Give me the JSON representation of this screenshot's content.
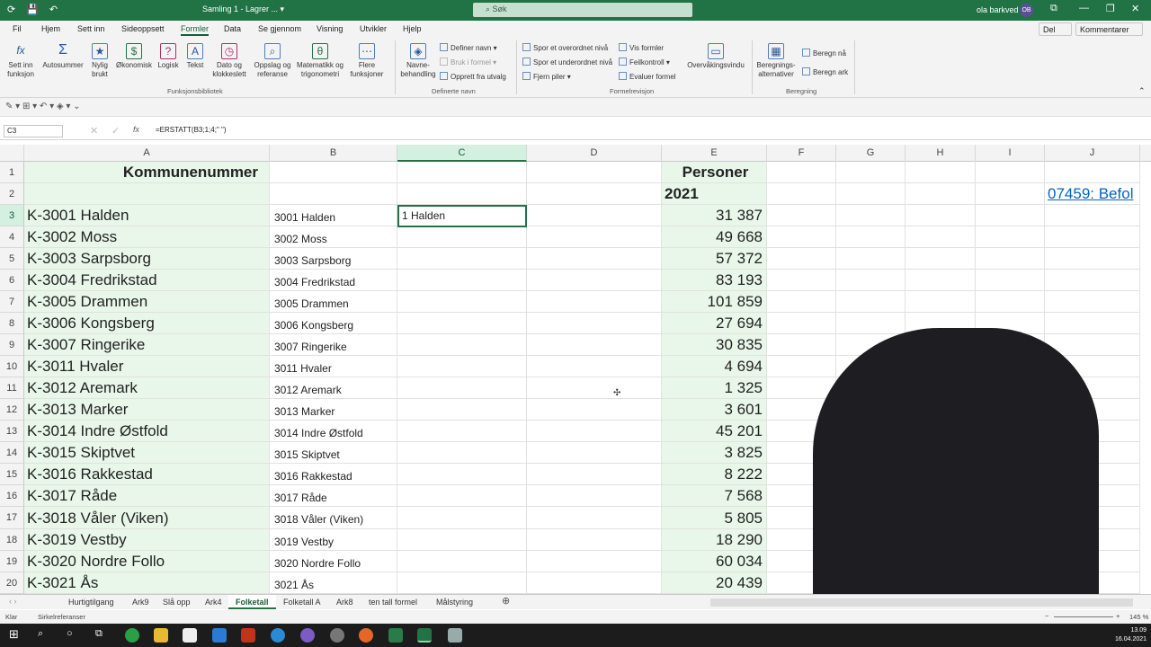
{
  "titlebar": {
    "autosave": "⟳",
    "save": "💾",
    "undo": "↶",
    "doc": "Samling 1  -  Lagrer ...  ▾",
    "search": "Søk",
    "user": "ola barkved",
    "initials": "OB",
    "minimize": "—",
    "restore": "❐",
    "close": "✕",
    "win_icon": "⧉"
  },
  "tabs": [
    "Fil",
    "Hjem",
    "Sett inn",
    "Sideoppsett",
    "Formler",
    "Data",
    "Se gjennom",
    "Visning",
    "Utvikler",
    "Hjelp"
  ],
  "share": "Del",
  "comments": "Kommentarer",
  "ribbon": {
    "big": [
      {
        "label": "Sett inn\nfunksjon",
        "icon": "fx"
      },
      {
        "label": "Autosummer",
        "icon": "Σ"
      },
      {
        "label": "Nylig\nbrukt",
        "icon": "★"
      },
      {
        "label": "Økonomisk",
        "icon": "$"
      },
      {
        "label": "Logisk",
        "icon": "?"
      },
      {
        "label": "Tekst",
        "icon": "A"
      },
      {
        "label": "Dato og\nklokkeslett",
        "icon": "◷"
      },
      {
        "label": "Oppslag og\nreferanse",
        "icon": "⌕"
      },
      {
        "label": "Matematikk og\ntrigonometri",
        "icon": "θ"
      },
      {
        "label": "Flere\nfunksjoner",
        "icon": "⋯"
      },
      {
        "label": "Navne-\nbehandling",
        "icon": "◈"
      },
      {
        "label": "Overvåkingsvindu",
        "icon": "▭"
      },
      {
        "label": "Beregnings-\nalternativer",
        "icon": "▦"
      }
    ],
    "small": [
      "Definer navn",
      "Bruk i formel",
      "Opprett fra utvalg",
      "Spor et overordnet nivå",
      "Spor et underordnet nivå",
      "Fjern piler",
      "Vis formler",
      "Feilkontroll",
      "Evaluer formel",
      "Beregn nå",
      "Beregn ark"
    ],
    "groups": [
      "Funksjonsbibliotek",
      "Definerte navn",
      "Formelrevisjon",
      "Beregning"
    ]
  },
  "namebox": "C3",
  "fx": "fx",
  "formula": "=ERSTATT(B3;1;4;\" \")",
  "columns": [
    "A",
    "B",
    "C",
    "D",
    "E",
    "F",
    "G",
    "H",
    "I",
    "J"
  ],
  "header": {
    "a1": "Kommunenummer",
    "e1": "Personer",
    "e2": "2021",
    "j2": "07459: Befol"
  },
  "rows": [
    {
      "n": "3",
      "a": "K-3001 Halden",
      "b": "3001 Halden",
      "e": "31 387"
    },
    {
      "n": "4",
      "a": "K-3002 Moss",
      "b": "3002 Moss",
      "e": "49 668"
    },
    {
      "n": "5",
      "a": "K-3003 Sarpsborg",
      "b": "3003 Sarpsborg",
      "e": "57 372"
    },
    {
      "n": "6",
      "a": "K-3004 Fredrikstad",
      "b": "3004 Fredrikstad",
      "e": "83 193"
    },
    {
      "n": "7",
      "a": "K-3005 Drammen",
      "b": "3005 Drammen",
      "e": "101 859"
    },
    {
      "n": "8",
      "a": "K-3006 Kongsberg",
      "b": "3006 Kongsberg",
      "e": "27 694"
    },
    {
      "n": "9",
      "a": "K-3007 Ringerike",
      "b": "3007 Ringerike",
      "e": "30 835"
    },
    {
      "n": "10",
      "a": "K-3011 Hvaler",
      "b": "3011 Hvaler",
      "e": "4 694"
    },
    {
      "n": "11",
      "a": "K-3012 Aremark",
      "b": "3012 Aremark",
      "e": "1 325"
    },
    {
      "n": "12",
      "a": "K-3013 Marker",
      "b": "3013 Marker",
      "e": "3 601"
    },
    {
      "n": "13",
      "a": "K-3014 Indre Østfold",
      "b": "3014 Indre Østfold",
      "e": "45 201"
    },
    {
      "n": "14",
      "a": "K-3015 Skiptvet",
      "b": "3015 Skiptvet",
      "e": "3 825"
    },
    {
      "n": "15",
      "a": "K-3016 Rakkestad",
      "b": "3016 Rakkestad",
      "e": "8 222"
    },
    {
      "n": "16",
      "a": "K-3017 Råde",
      "b": "3017 Råde",
      "e": "7 568"
    },
    {
      "n": "17",
      "a": "K-3018 Våler (Viken)",
      "b": "3018 Våler (Viken)",
      "e": "5 805"
    },
    {
      "n": "18",
      "a": "K-3019 Vestby",
      "b": "3019 Vestby",
      "e": "18 290"
    },
    {
      "n": "19",
      "a": "K-3020 Nordre Follo",
      "b": "3020 Nordre Follo",
      "e": "60 034"
    },
    {
      "n": "20",
      "a": "K-3021 Ås",
      "b": "3021 Ås",
      "e": "20 439"
    }
  ],
  "c3": "1 Halden",
  "sheets": [
    "Hurtigtilgang",
    "Ark9",
    "Slå opp",
    "Ark4",
    "Folketall",
    "Folketall A",
    "Ark8",
    "ten tall formel",
    "Målstyring"
  ],
  "active_sheet": "Folketall",
  "status": {
    "ready": "Klar",
    "circ": "Sirkelreferanser",
    "zoom": "145 %"
  },
  "clock": {
    "time": "13.09",
    "date": "16.04.2021"
  },
  "colors": {
    "excel_green": "#217346",
    "cell_green": "#e9f7ea",
    "link": "#0563c1"
  }
}
